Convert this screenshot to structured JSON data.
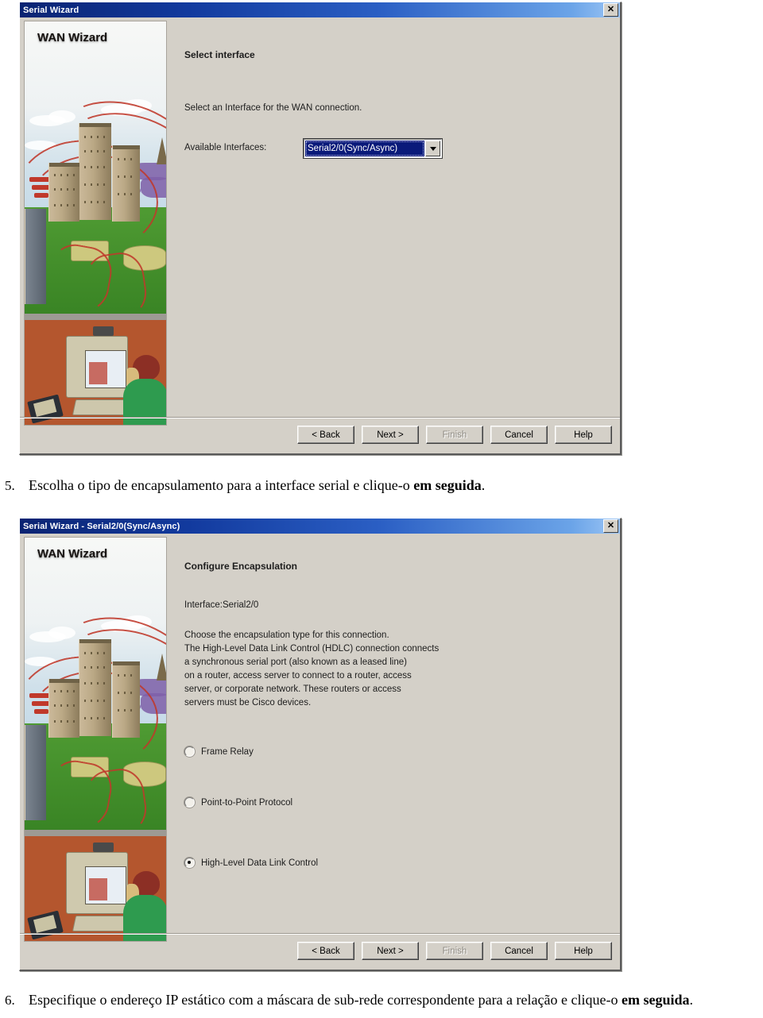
{
  "document": {
    "steps": [
      {
        "number": "5.",
        "text_before": "Escolha o tipo de encapsulamento para a interface serial e clique-o ",
        "text_bold": "em seguida",
        "text_after": "."
      },
      {
        "number": "6.",
        "text_before": "Especifique o endereço IP estático com a máscara de sub-rede correspondente para a relação e clique-o ",
        "text_bold": "em seguida",
        "text_after": "."
      }
    ]
  },
  "dialog1": {
    "title": "Serial Wizard",
    "close_icon": "close-icon",
    "sidebar": {
      "label": "WAN Wizard",
      "illustration": "wan-network-illustration"
    },
    "heading": "Select interface",
    "instruction": "Select an Interface for the WAN connection.",
    "field": {
      "label": "Available Interfaces:",
      "value": "Serial2/0(Sync/Async)",
      "dropdown_icon": "chevron-down-icon"
    },
    "buttons": [
      {
        "label": "< Back",
        "disabled": false
      },
      {
        "label": "Next >",
        "disabled": false
      },
      {
        "label": "Finish",
        "disabled": true
      },
      {
        "label": "Cancel",
        "disabled": false
      },
      {
        "label": "Help",
        "disabled": false
      }
    ]
  },
  "dialog2": {
    "title": "Serial Wizard - Serial2/0(Sync/Async)",
    "close_icon": "close-icon",
    "sidebar": {
      "label": "WAN Wizard",
      "illustration": "wan-network-illustration"
    },
    "heading": "Configure Encapsulation",
    "interface_line": "Interface:Serial2/0",
    "description_lines": [
      "Choose the encapsulation type for this connection.",
      "The High-Level Data Link Control (HDLC) connection connects",
      "a synchronous serial port (also known as a leased line)",
      "on a router, access server to connect to a router, access",
      "server, or corporate network. These routers or access",
      "servers must be Cisco devices."
    ],
    "options": [
      {
        "label": "Frame Relay",
        "selected": false
      },
      {
        "label": "Point-to-Point Protocol",
        "selected": false
      },
      {
        "label": "High-Level Data Link Control",
        "selected": true
      }
    ],
    "buttons": [
      {
        "label": "< Back",
        "disabled": false
      },
      {
        "label": "Next >",
        "disabled": false
      },
      {
        "label": "Finish",
        "disabled": true
      },
      {
        "label": "Cancel",
        "disabled": false
      },
      {
        "label": "Help",
        "disabled": false
      }
    ]
  },
  "colors": {
    "titlebar_start": "#0a2372",
    "titlebar_end": "#9dc6f5",
    "dialog_face": "#d4d0c8",
    "selection": "#0a1a7a",
    "page_background": "#ffffff"
  }
}
